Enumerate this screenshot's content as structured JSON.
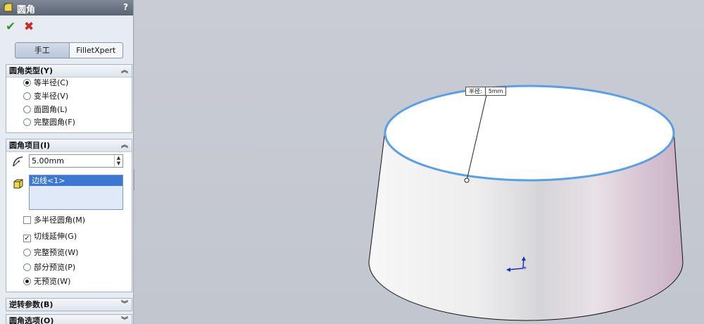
{
  "panel": {
    "title": "圆角",
    "help": "?",
    "ok_icon": "✔",
    "cancel_icon": "✖",
    "modes": [
      "手工",
      "FilletXpert"
    ],
    "fillet_type": {
      "header": "圆角类型(Y)",
      "options": [
        {
          "label": "等半径(C)",
          "selected": true
        },
        {
          "label": "变半径(V)",
          "selected": false
        },
        {
          "label": "面圆角(L)",
          "selected": false
        },
        {
          "label": "完整圆角(F)",
          "selected": false
        }
      ]
    },
    "fillet_items": {
      "header": "圆角项目(I)",
      "radius_value": "5.00mm",
      "edge_selection": "边线<1>",
      "multi_radius": "多半径圆角(M)",
      "tangent": "切线延伸(G)",
      "preview_options": [
        {
          "label": "完整预览(W)",
          "selected": false
        },
        {
          "label": "部分预览(P)",
          "selected": false
        },
        {
          "label": "无预览(W)",
          "selected": true
        }
      ]
    },
    "reverse_params": "逆转参数(B)",
    "fillet_options": "圆角选项(O)"
  },
  "viewport": {
    "dim_label": "半径:",
    "dim_value": "5mm"
  },
  "colors": {
    "edge_highlight": "#5aa0e6",
    "panel_bg": "#e7ebf2",
    "viewport_bg": "#c4c8cf"
  }
}
